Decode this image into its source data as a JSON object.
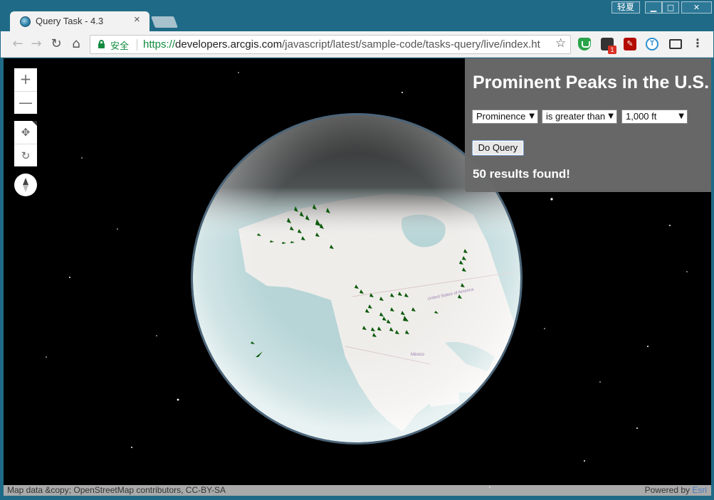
{
  "window": {
    "user_badge": "轻夏",
    "min_icon": "minimize-icon",
    "max_icon": "maximize-icon",
    "close_icon": "close-icon"
  },
  "tab": {
    "title": "Query Task - 4.3",
    "favicon": "globe-icon"
  },
  "toolbar": {
    "secure_label": "安全",
    "url_scheme": "https://",
    "url_host": "developers.arcgis.com",
    "url_path": "/javascript/latest/sample-code/tasks-query/live/index.ht",
    "extensions": [
      "shield-extension-icon",
      "game-extension-icon",
      "pdf-extension-icon",
      "translate-extension-icon",
      "cast-extension-icon"
    ],
    "extension_badge": "1"
  },
  "map_controls": {
    "zoom_in": "+",
    "zoom_out": "—",
    "pan": "✥",
    "rotate": "↻"
  },
  "panel": {
    "title": "Prominent Peaks in the U.S.",
    "attribute_select": "Prominence",
    "operator_select": "is greater than",
    "value_select": "1,000 ft",
    "query_button": "Do Query",
    "result_text": "50 results found!"
  },
  "map": {
    "labels": {
      "usa": "United States of America",
      "mexico": "México"
    },
    "ocean_color": "#b7d5d7",
    "land_color": "#efedea",
    "marker_color": "#0b5a0b"
  },
  "attribution": {
    "left": "Map data &copy; OpenStreetMap contributors, CC-BY-SA",
    "powered_by": "Powered by ",
    "esri": "Esri"
  }
}
